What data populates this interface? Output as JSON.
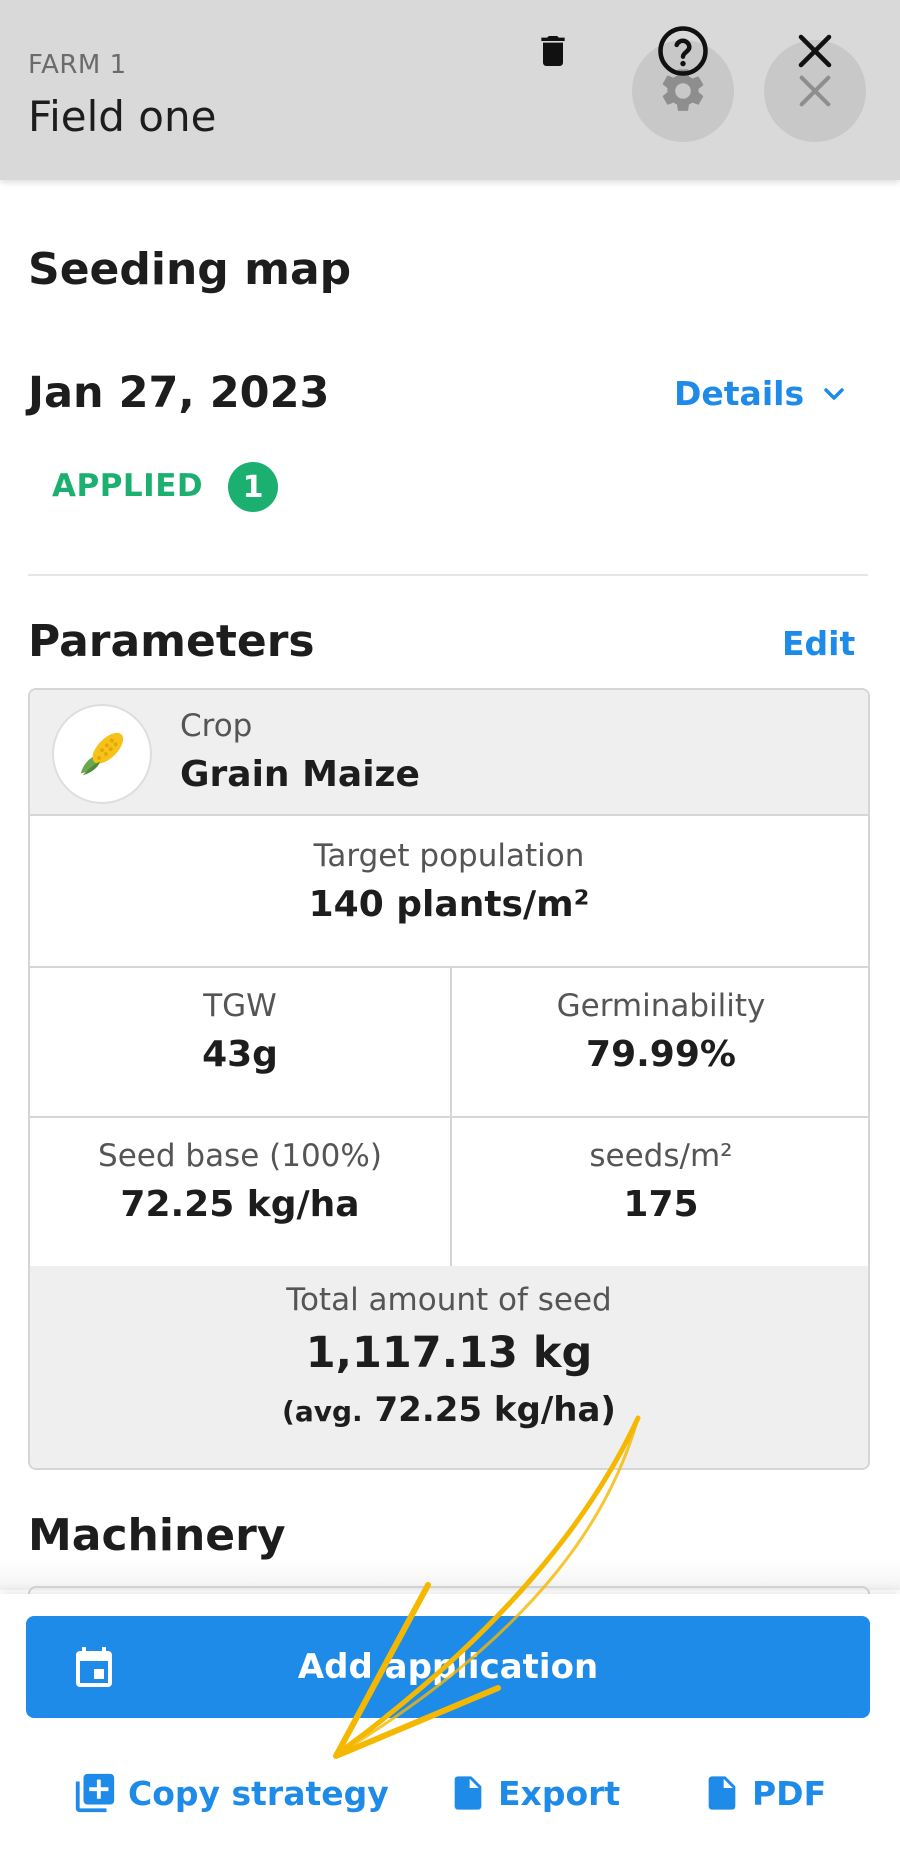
{
  "header": {
    "farm": "FARM 1",
    "field": "Field one",
    "settings_icon": "gear-icon",
    "close_icon": "close-icon"
  },
  "panel": {
    "title": "Seeding map",
    "date": "Jan 27, 2023",
    "details_label": "Details",
    "status": "APPLIED",
    "status_count": "1",
    "colors": {
      "accent": "#1f8be9",
      "applied": "#1bb070"
    }
  },
  "parameters": {
    "title": "Parameters",
    "edit_label": "Edit",
    "crop_label": "Crop",
    "crop_name": "Grain Maize",
    "target_population_label": "Target population",
    "target_population_value": "140 plants/m²",
    "tgw_label": "TGW",
    "tgw_value": "43g",
    "germinability_label": "Germinability",
    "germinability_value": "79.99%",
    "seed_base_label": "Seed base (100%)",
    "seed_base_value": "72.25 kg/ha",
    "seeds_label": "seeds/m²",
    "seeds_value": "175",
    "total_label": "Total amount of seed",
    "total_value": "1,117.13 kg",
    "avg_prefix": "(avg.",
    "avg_value": "72.25 kg/ha)"
  },
  "machinery": {
    "title": "Machinery"
  },
  "actions": {
    "add_application": "Add application",
    "copy_strategy": "Copy strategy",
    "export": "Export",
    "pdf": "PDF"
  }
}
